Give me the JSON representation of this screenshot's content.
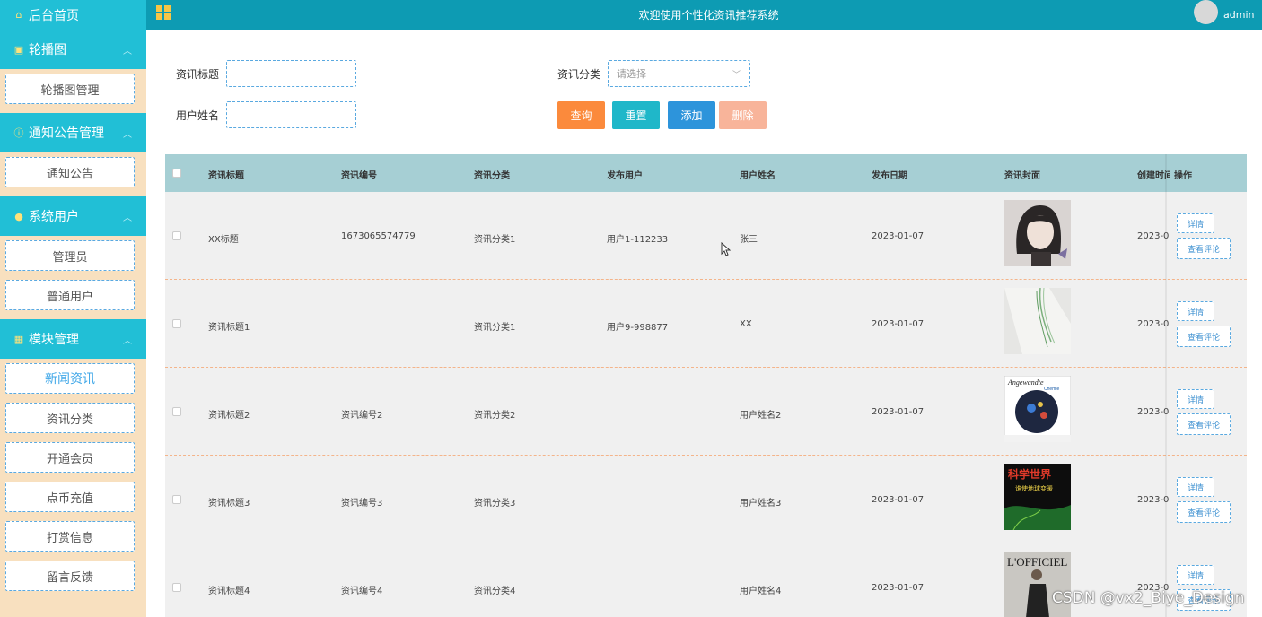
{
  "topbar": {
    "title": "欢迎使用个性化资讯推荐系统",
    "user": "admin"
  },
  "sidebar": {
    "home": "后台首页",
    "groups": [
      {
        "title": "轮播图",
        "items": [
          "轮播图管理"
        ]
      },
      {
        "title": "通知公告管理",
        "items": [
          "通知公告"
        ]
      },
      {
        "title": "系统用户",
        "items": [
          "管理员",
          "普通用户"
        ]
      },
      {
        "title": "模块管理",
        "items": [
          "新闻资讯",
          "资讯分类",
          "开通会员",
          "点币充值",
          "打赏信息",
          "留言反馈"
        ]
      }
    ]
  },
  "search": {
    "title_label": "资讯标题",
    "category_label": "资讯分类",
    "category_placeholder": "请选择",
    "username_label": "用户姓名",
    "buttons": {
      "query": "查询",
      "reset": "重置",
      "add": "添加",
      "delete": "删除"
    }
  },
  "colors": {
    "query": "#fb8a3c",
    "reset": "#1fb7c9",
    "add": "#2d94db",
    "delete": "#f8b49a"
  },
  "table": {
    "headers": [
      "资讯标题",
      "资讯编号",
      "资讯分类",
      "发布用户",
      "用户姓名",
      "发布日期",
      "资讯封面",
      "创建时间",
      "操作"
    ],
    "rows": [
      {
        "title": "XX标题",
        "code": "1673065574779",
        "category": "资讯分类1",
        "publisher": "用户1-112233",
        "username": "张三",
        "date": "2023-01-07",
        "created": "2023-0"
      },
      {
        "title": "资讯标题1",
        "code": "",
        "category": "资讯分类1",
        "publisher": "用户9-998877",
        "username": "XX",
        "date": "2023-01-07",
        "created": "2023-0"
      },
      {
        "title": "资讯标题2",
        "code": "资讯编号2",
        "category": "资讯分类2",
        "publisher": "",
        "username": "用户姓名2",
        "date": "2023-01-07",
        "created": "2023-0"
      },
      {
        "title": "资讯标题3",
        "code": "资讯编号3",
        "category": "资讯分类3",
        "publisher": "",
        "username": "用户姓名3",
        "date": "2023-01-07",
        "created": "2023-0"
      },
      {
        "title": "资讯标题4",
        "code": "资讯编号4",
        "category": "资讯分类4",
        "publisher": "",
        "username": "用户姓名4",
        "date": "2023-01-07",
        "created": "2023-0"
      }
    ],
    "ops": {
      "detail": "详情",
      "comments": "查看评论"
    },
    "cover_texts": {
      "cover3": "Angewandte",
      "cover3b": "Chemie",
      "cover4": "科学世界",
      "cover4b": "谁使地球变暖",
      "cover5": "L'OFFICIEL"
    }
  },
  "watermark": "CSDN @vx2_Biye_Design"
}
